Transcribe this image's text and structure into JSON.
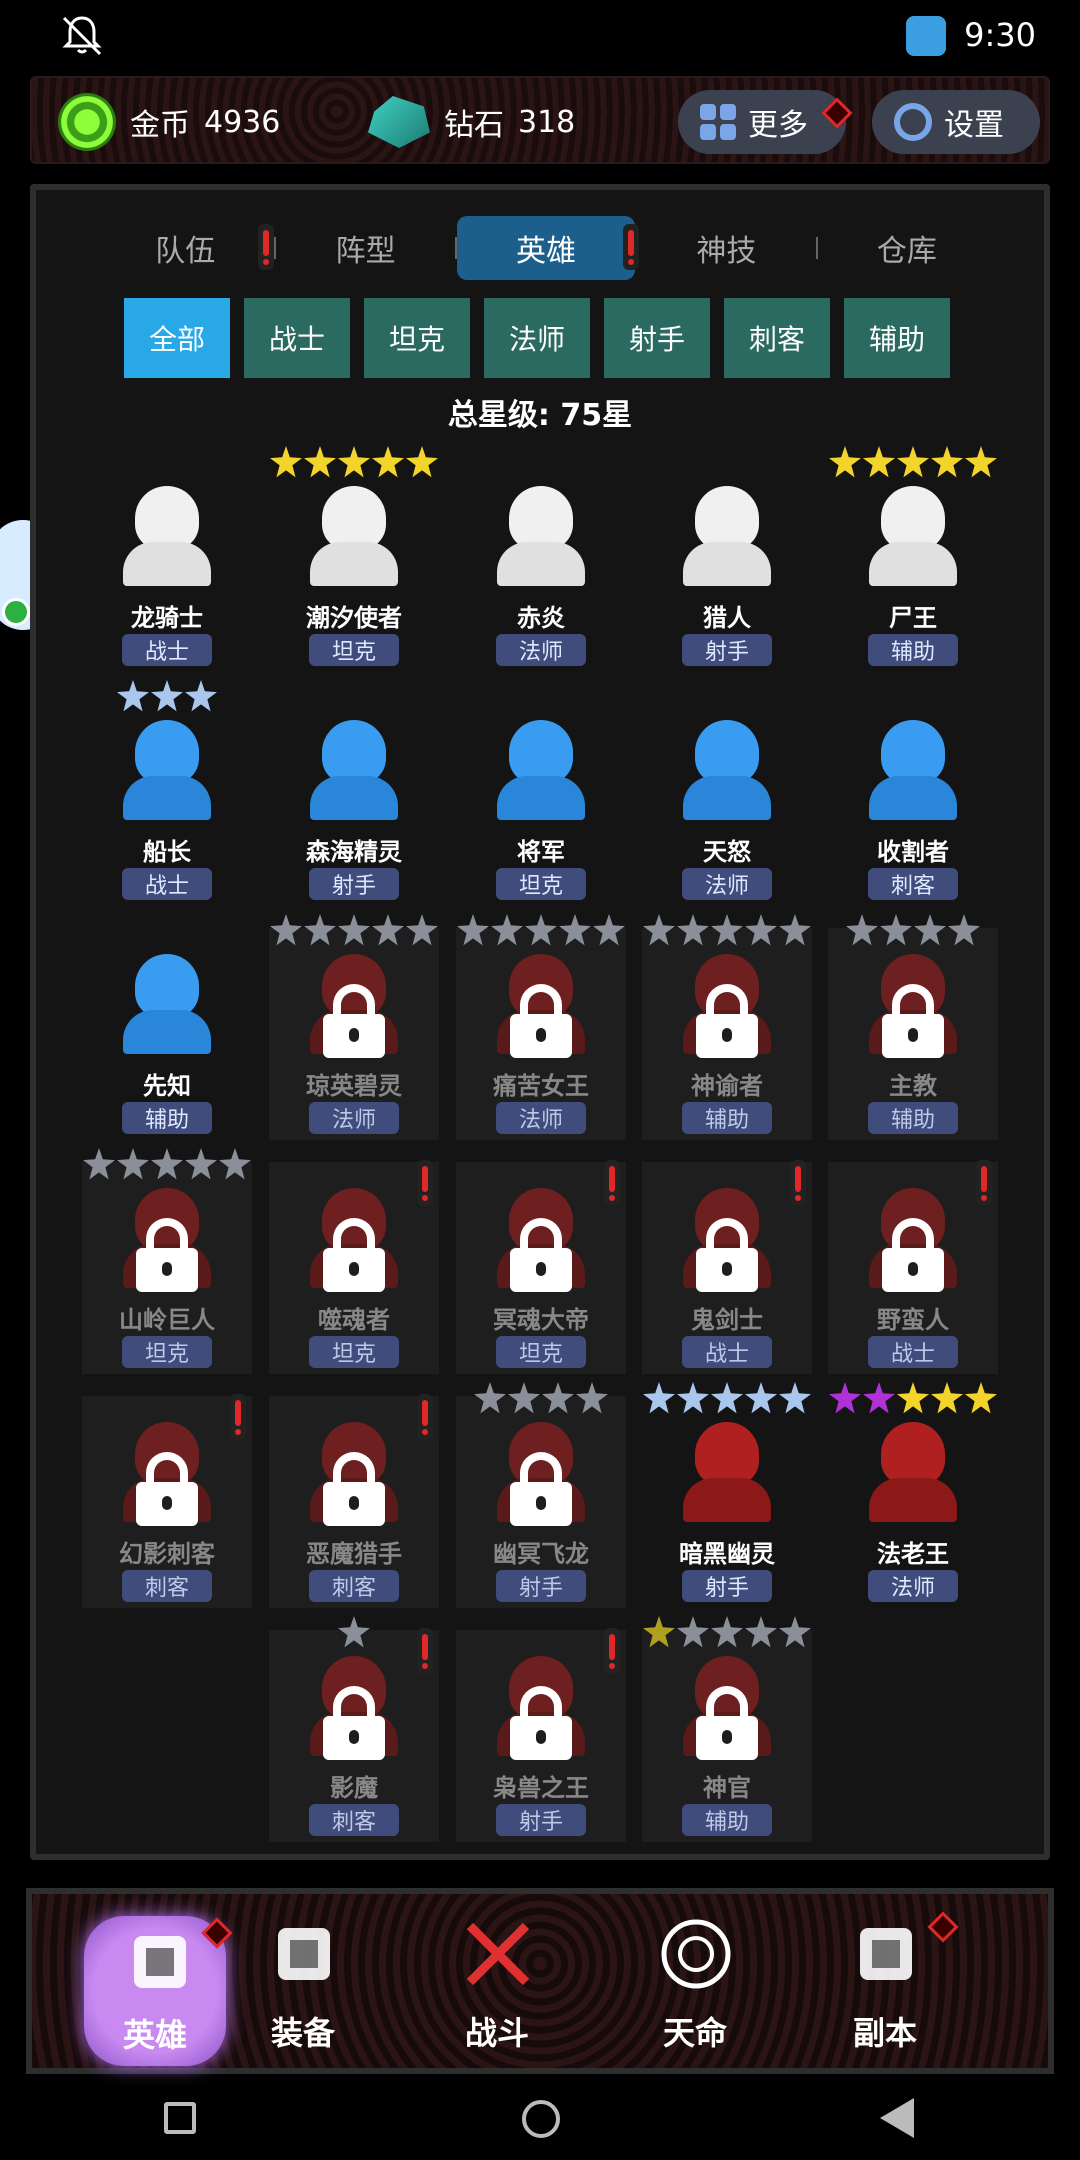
{
  "status": {
    "time": "9:30"
  },
  "resources": {
    "gold_label": "金币",
    "gold_value": "4936",
    "gem_label": "钻石",
    "gem_value": "318",
    "more_label": "更多",
    "settings_label": "设置"
  },
  "tabs": [
    "队伍",
    "阵型",
    "英雄",
    "神技",
    "仓库"
  ],
  "active_tab": "英雄",
  "filters": [
    "全部",
    "战士",
    "坦克",
    "法师",
    "射手",
    "刺客",
    "辅助"
  ],
  "active_filter": "全部",
  "total_stars": "总星级: 75星",
  "heroes": [
    {
      "name": "龙骑士",
      "role": "战士",
      "locked": false,
      "color": "white",
      "stars": []
    },
    {
      "name": "潮汐使者",
      "role": "坦克",
      "locked": false,
      "color": "white",
      "stars": [
        "gold",
        "gold",
        "gold",
        "gold",
        "gold"
      ]
    },
    {
      "name": "赤炎",
      "role": "法师",
      "locked": false,
      "color": "white",
      "stars": []
    },
    {
      "name": "猎人",
      "role": "射手",
      "locked": false,
      "color": "white",
      "stars": []
    },
    {
      "name": "尸王",
      "role": "辅助",
      "locked": false,
      "color": "white",
      "stars": [
        "gold",
        "gold",
        "gold",
        "gold",
        "gold"
      ]
    },
    {
      "name": "船长",
      "role": "战士",
      "locked": false,
      "color": "blue",
      "stars": [
        "blue",
        "blue",
        "blue"
      ]
    },
    {
      "name": "森海精灵",
      "role": "射手",
      "locked": false,
      "color": "blue",
      "stars": []
    },
    {
      "name": "将军",
      "role": "坦克",
      "locked": false,
      "color": "blue",
      "stars": []
    },
    {
      "name": "天怒",
      "role": "法师",
      "locked": false,
      "color": "blue",
      "stars": []
    },
    {
      "name": "收割者",
      "role": "刺客",
      "locked": false,
      "color": "blue",
      "stars": []
    },
    {
      "name": "先知",
      "role": "辅助",
      "locked": false,
      "color": "blue",
      "stars": []
    },
    {
      "name": "琼英碧灵",
      "role": "法师",
      "locked": true,
      "color": "red",
      "stars": [
        "gray",
        "gray",
        "gray",
        "gray",
        "gray"
      ]
    },
    {
      "name": "痛苦女王",
      "role": "法师",
      "locked": true,
      "color": "red",
      "stars": [
        "gray",
        "gray",
        "gray",
        "gray",
        "gray"
      ]
    },
    {
      "name": "神谕者",
      "role": "辅助",
      "locked": true,
      "color": "red",
      "stars": [
        "gray",
        "gray",
        "gray",
        "gray",
        "gray"
      ]
    },
    {
      "name": "主教",
      "role": "辅助",
      "locked": true,
      "color": "red",
      "stars": [
        "gray",
        "gray",
        "gray",
        "gray"
      ]
    },
    {
      "name": "山岭巨人",
      "role": "坦克",
      "locked": true,
      "color": "red",
      "stars": [
        "gray",
        "gray",
        "gray",
        "gray",
        "gray"
      ]
    },
    {
      "name": "噬魂者",
      "role": "坦克",
      "locked": true,
      "color": "red",
      "stars": [],
      "alert": true
    },
    {
      "name": "冥魂大帝",
      "role": "坦克",
      "locked": true,
      "color": "red",
      "stars": [],
      "alert": true
    },
    {
      "name": "鬼剑士",
      "role": "战士",
      "locked": true,
      "color": "red",
      "stars": [],
      "alert": true
    },
    {
      "name": "野蛮人",
      "role": "战士",
      "locked": true,
      "color": "red",
      "stars": [],
      "alert": true
    },
    {
      "name": "幻影刺客",
      "role": "刺客",
      "locked": true,
      "color": "red",
      "stars": [],
      "alert": true
    },
    {
      "name": "恶魔猎手",
      "role": "刺客",
      "locked": true,
      "color": "red",
      "stars": [],
      "alert": true
    },
    {
      "name": "幽冥飞龙",
      "role": "射手",
      "locked": true,
      "color": "red",
      "stars": [
        "gray",
        "gray",
        "gray",
        "gray"
      ]
    },
    {
      "name": "暗黑幽灵",
      "role": "射手",
      "locked": false,
      "color": "red",
      "stars": [
        "blue",
        "blue",
        "blue",
        "blue",
        "blue"
      ]
    },
    {
      "name": "法老王",
      "role": "法师",
      "locked": false,
      "color": "red",
      "stars": [
        "purple",
        "purple",
        "gold",
        "gold",
        "gold"
      ]
    },
    {
      "name": "影魔",
      "role": "刺客",
      "locked": true,
      "color": "red",
      "stars": [
        "gray"
      ],
      "alert": true
    },
    {
      "name": "枭兽之王",
      "role": "射手",
      "locked": true,
      "color": "red",
      "stars": [],
      "alert": true
    },
    {
      "name": "神官",
      "role": "辅助",
      "locked": true,
      "color": "red",
      "stars": [
        "olive",
        "gray",
        "gray",
        "gray",
        "gray"
      ]
    }
  ],
  "nav": [
    "英雄",
    "装备",
    "战斗",
    "天命",
    "副本"
  ],
  "active_nav": "英雄"
}
